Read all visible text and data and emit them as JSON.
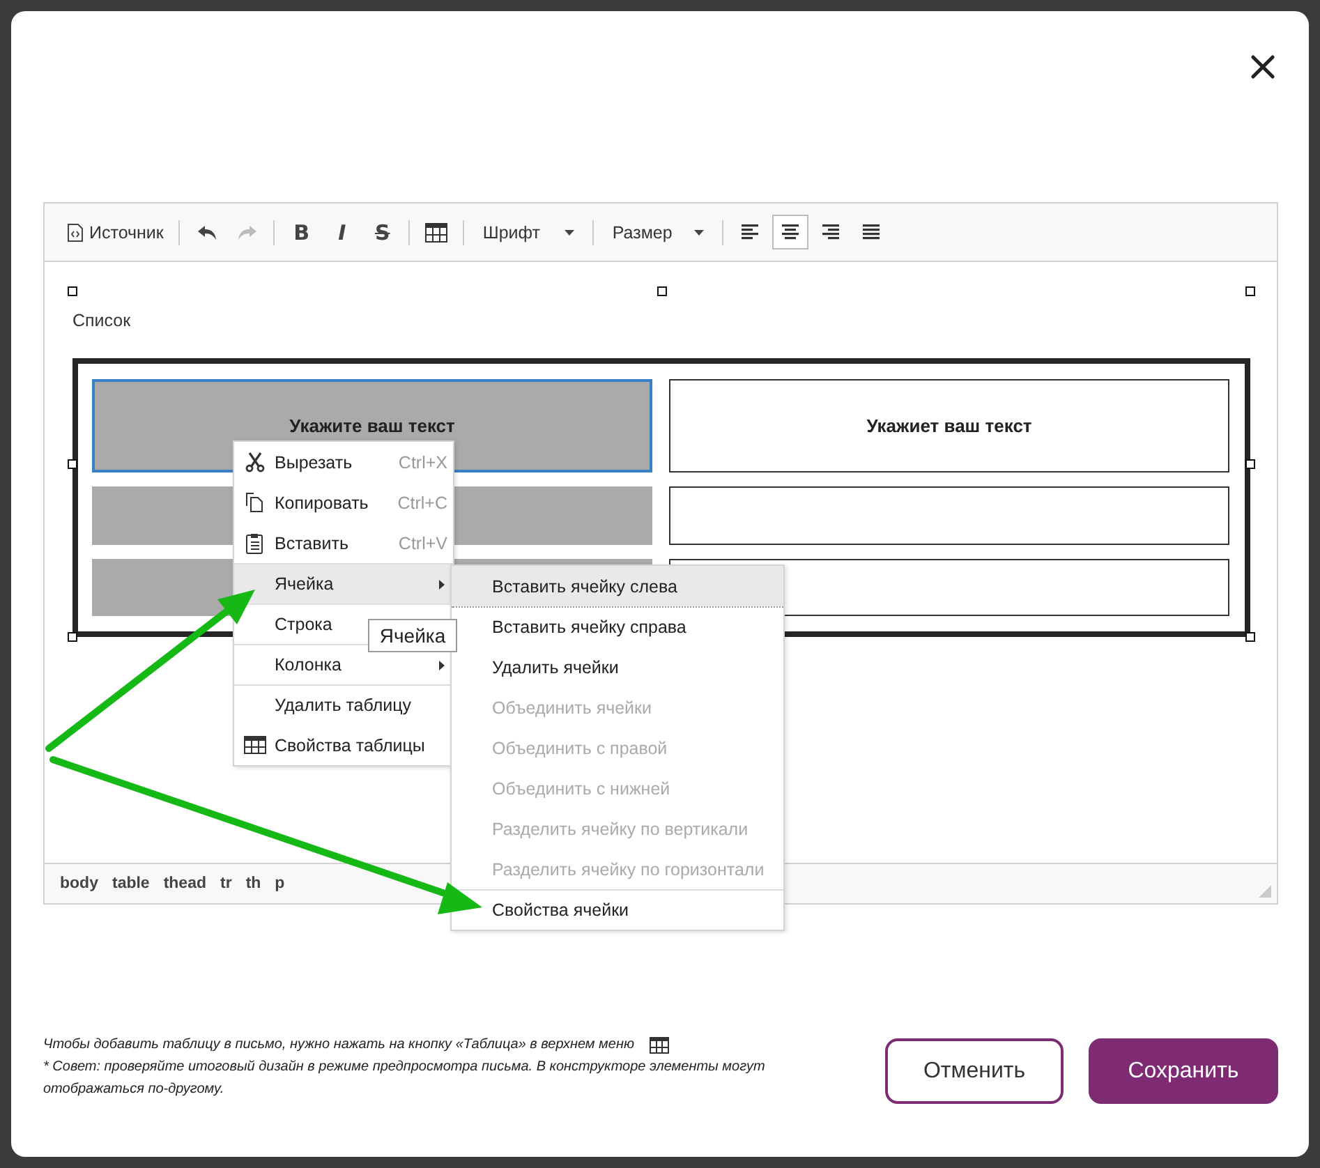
{
  "toolbar_groups": [
    [
      {
        "kind": "source",
        "label": "Источник"
      }
    ],
    [
      {
        "kind": "undo",
        "disabled": false
      },
      {
        "kind": "redo",
        "disabled": true
      }
    ],
    [
      {
        "kind": "text",
        "label": "B"
      },
      {
        "kind": "text",
        "label": "I"
      },
      {
        "kind": "text",
        "label": "S"
      }
    ],
    [
      {
        "kind": "table"
      }
    ],
    [
      {
        "kind": "combo",
        "label": "Шрифт"
      }
    ],
    [
      {
        "kind": "combo",
        "label": "Размер"
      }
    ],
    [
      {
        "kind": "align",
        "selected": false
      },
      {
        "kind": "align",
        "selected": true
      },
      {
        "kind": "align",
        "selected": false
      },
      {
        "kind": "align",
        "selected": false
      }
    ]
  ],
  "content": {
    "caption": "Список",
    "table_rows": [
      [
        {
          "text": "Укажите ваш текст",
          "shaded": true,
          "selected": true
        },
        {
          "text": "Укажиет ваш текст",
          "shaded": false,
          "selected": false
        }
      ],
      [
        {
          "shaded": true,
          "selected": false
        },
        {
          "shaded": false,
          "selected": false
        }
      ],
      [
        {
          "shaded": true,
          "selected": false
        },
        {
          "shaded": false,
          "selected": false
        }
      ]
    ]
  },
  "path_bar": [
    "body",
    "table",
    "thead",
    "tr",
    "th",
    "p"
  ],
  "context_menu": [
    {
      "label": "Вырезать",
      "shortcut": "Ctrl+X",
      "selected": false,
      "submenu": false,
      "divider_before": false
    },
    {
      "label": "Копировать",
      "shortcut": "Ctrl+C",
      "selected": false,
      "submenu": false,
      "divider_before": false
    },
    {
      "label": "Вставить",
      "shortcut": "Ctrl+V",
      "selected": false,
      "submenu": false,
      "divider_before": false
    },
    {
      "label": "Ячейка",
      "selected": true,
      "submenu": true,
      "divider_before": true
    },
    {
      "label": "Строка",
      "selected": false,
      "submenu": false,
      "divider_before": true
    },
    {
      "label": "Колонка",
      "selected": false,
      "submenu": true,
      "divider_before": true
    },
    {
      "label": "Удалить таблицу",
      "selected": false,
      "submenu": false,
      "divider_before": true
    },
    {
      "label": "Свойства таблицы",
      "selected": false,
      "submenu": false,
      "divider_before": false
    }
  ],
  "submenu": [
    {
      "label": "Вставить ячейку слева",
      "disabled": false,
      "selected": true,
      "divider_before": false
    },
    {
      "label": "Вставить ячейку справа",
      "disabled": false,
      "selected": false,
      "divider_before": true
    },
    {
      "label": "Удалить ячейки",
      "disabled": false,
      "selected": false,
      "divider_before": false
    },
    {
      "label": "Объединить ячейки",
      "disabled": true,
      "selected": false,
      "divider_before": false
    },
    {
      "label": "Объединить с правой",
      "disabled": true,
      "selected": false,
      "divider_before": false
    },
    {
      "label": "Объединить с нижней",
      "disabled": true,
      "selected": false,
      "divider_before": false
    },
    {
      "label": "Разделить ячейку по вертикали",
      "disabled": true,
      "selected": false,
      "divider_before": false
    },
    {
      "label": "Разделить ячейку по горизонтали",
      "disabled": true,
      "selected": false,
      "divider_before": false
    },
    {
      "label": "Свойства ячейки",
      "disabled": false,
      "selected": false,
      "divider_before": true
    }
  ],
  "tooltip": "Ячейка",
  "footer": {
    "notes": [
      "Чтобы добавить таблицу в письмо, нужно нажать на кнопку «Таблица» в верхнем меню",
      "* Совет: проверяйте итоговый дизайн в режиме предпросмотра письма. В конструкторе элементы могут отображаться по-другому."
    ],
    "buttons": [
      {
        "label": "Отменить",
        "kind": "secondary"
      },
      {
        "label": "Сохранить",
        "kind": "primary"
      }
    ]
  }
}
